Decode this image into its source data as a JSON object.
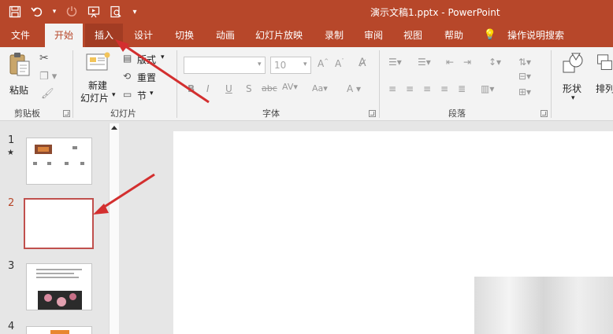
{
  "titlebar": {
    "document_title": "演示文稿1.pptx  -  PowerPoint",
    "color": "#b7472a",
    "quick_access": [
      "save-icon",
      "undo-icon",
      "undo-dropdown-icon",
      "redo-icon",
      "start-from-beginning-icon",
      "print-preview-icon",
      "customize-qat-icon"
    ]
  },
  "tabs": [
    {
      "label": "文件"
    },
    {
      "label": "开始",
      "active": true
    },
    {
      "label": "插入"
    },
    {
      "label": "设计"
    },
    {
      "label": "切换"
    },
    {
      "label": "动画"
    },
    {
      "label": "幻灯片放映"
    },
    {
      "label": "录制"
    },
    {
      "label": "审阅"
    },
    {
      "label": "视图"
    },
    {
      "label": "帮助"
    },
    {
      "label": "操作说明搜索"
    }
  ],
  "ribbon": {
    "clipboard": {
      "paste": "粘贴",
      "group": "剪贴板"
    },
    "slides": {
      "new_slide_line1": "新建",
      "new_slide_line2": "幻灯片",
      "layout": "版式",
      "reset": "重置",
      "section": "节",
      "group": "幻灯片"
    },
    "font": {
      "font_size": "10",
      "group": "字体"
    },
    "paragraph": {
      "group": "段落"
    },
    "drawing": {
      "shapes": "形状",
      "arrange": "排列"
    }
  },
  "slide_pane": {
    "slides": [
      {
        "number": "1",
        "star": "★"
      },
      {
        "number": "2",
        "selected": true
      },
      {
        "number": "3"
      },
      {
        "number": "4"
      }
    ]
  },
  "accent_colors": {
    "brand": "#b7472a",
    "selection": "#c0504d",
    "annotation_arrow": "#d32f2f"
  }
}
